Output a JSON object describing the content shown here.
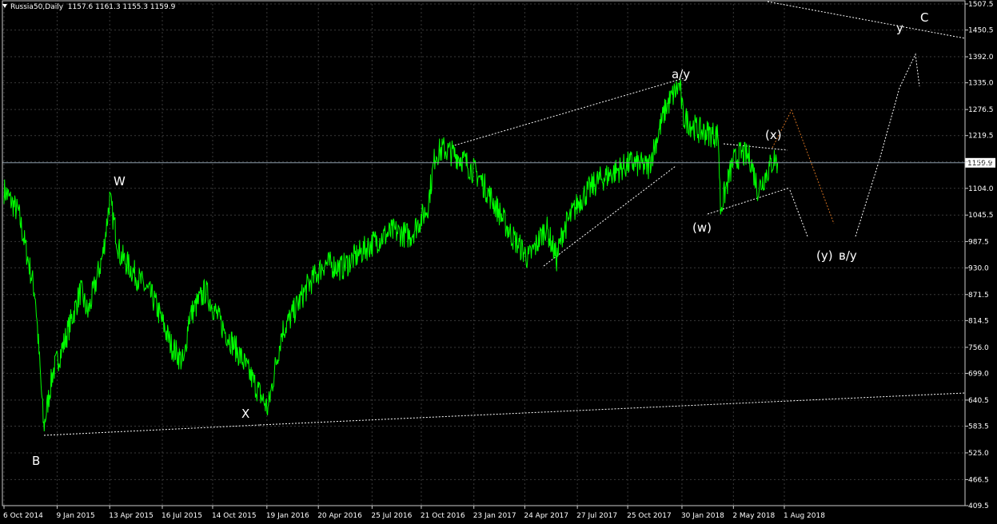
{
  "header": {
    "symbol": "Russia50,Daily",
    "ohlc": "1157.6 1161.3 1155.3 1159.9"
  },
  "current_price_label": "1159.9",
  "colors": {
    "background": "#000000",
    "grid": "#3a3a3a",
    "price_line": "#00ff00",
    "axis_text": "#ffffff",
    "projection_orange": "#d07020",
    "projection_white": "#ffffff"
  },
  "chart_data": {
    "type": "line",
    "title": "",
    "xlabel": "",
    "ylabel": "",
    "symbol": "Russia50",
    "timeframe": "Daily",
    "ylim": [
      409.5,
      1507.5
    ],
    "y_ticks": [
      "1507.5",
      "1450.5",
      "1392.0",
      "1335.0",
      "1276.5",
      "1219.5",
      "1162.5",
      "1104.0",
      "1045.5",
      "987.5",
      "930.0",
      "871.5",
      "814.5",
      "756.0",
      "699.0",
      "640.5",
      "583.5",
      "525.0",
      "466.5",
      "409.5"
    ],
    "x_ticks": [
      "6 Oct 2014",
      "9 Jan 2015",
      "13 Apr 2015",
      "16 Jul 2015",
      "14 Oct 2015",
      "19 Jan 2016",
      "20 Apr 2016",
      "25 Jul 2016",
      "21 Oct 2016",
      "23 Jan 2017",
      "24 Apr 2017",
      "27 Jul 2017",
      "25 Oct 2017",
      "30 Jan 2018",
      "2 May 2018",
      "1 Aug 2018"
    ],
    "grid": true,
    "current_price": 1159.9,
    "series": [
      {
        "x": [
          "6 Oct 2014",
          "1 Nov 2014",
          "1 Dec 2014",
          "16 Dec 2014",
          "1 Jan 2015",
          "20 Jan 2015",
          "20 Feb 2015",
          "5 Mar 2015",
          "1 Apr 2015",
          "13 Apr 2015",
          "1 May 2015",
          "1 Jun 2015",
          "1 Jul 2015",
          "1 Aug 2015",
          "24 Aug 2015",
          "1 Sep 2015",
          "1 Oct 2015",
          "1 Nov 2015",
          "1 Dec 2015",
          "21 Jan 2016",
          "1 Feb 2016",
          "15 Feb 2016",
          "1 Mar 2016",
          "1 Apr 2016",
          "1 May 2016",
          "1 Jun 2016",
          "1 Jul 2016",
          "1 Aug 2016",
          "1 Sep 2016",
          "1 Oct 2016",
          "1 Nov 2016",
          "15 Nov 2016",
          "1 Dec 2016",
          "1 Jan 2017",
          "1 Feb 2017",
          "1 Mar 2017",
          "1 Apr 2017",
          "1 May 2017",
          "1 Jun 2017",
          "20 Jun 2017",
          "1 Jul 2017",
          "1 Aug 2017",
          "1 Sep 2017",
          "1 Oct 2017",
          "1 Nov 2017",
          "1 Dec 2017",
          "1 Jan 2018",
          "20 Jan 2018",
          "26 Jan 2018",
          "1 Feb 2018",
          "1 Mar 2018",
          "5 Apr 2018",
          "9 Apr 2018",
          "1 May 2018",
          "15 May 2018",
          "1 Jun 2018",
          "15 Jun 2018",
          "1 Jul 2018",
          "15 Jul 2018",
          "20 Jul 2018"
        ],
        "y": [
          1100,
          1050,
          870,
          580,
          700,
          760,
          880,
          830,
          960,
          1080,
          960,
          910,
          860,
          760,
          720,
          820,
          880,
          800,
          740,
          620,
          700,
          790,
          820,
          890,
          940,
          930,
          960,
          990,
          1010,
          1000,
          1060,
          1180,
          1190,
          1170,
          1130,
          1070,
          1000,
          950,
          1020,
          950,
          1010,
          1080,
          1120,
          1140,
          1160,
          1150,
          1280,
          1320,
          1330,
          1260,
          1230,
          1220,
          1060,
          1160,
          1180,
          1170,
          1100,
          1140,
          1170,
          1160
        ]
      }
    ],
    "annotations": [
      "B",
      "W",
      "X",
      "a/y",
      "(w)",
      "(x)",
      "(y)",
      "в/у",
      "у",
      "C"
    ]
  }
}
